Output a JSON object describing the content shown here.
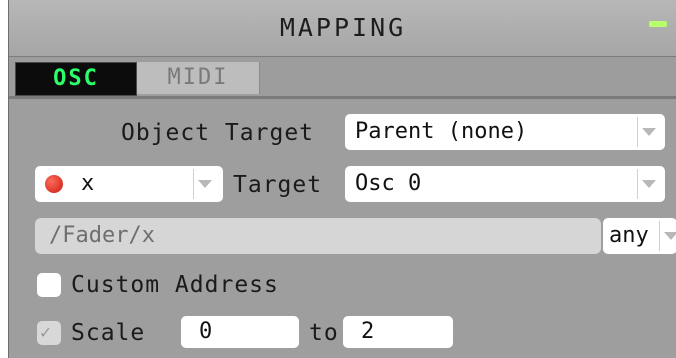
{
  "panel": {
    "title": "MAPPING",
    "minimize_color": "#b9ff6a"
  },
  "tabs": [
    {
      "label": "OSC",
      "active": true
    },
    {
      "label": "MIDI",
      "active": false
    }
  ],
  "object_target": {
    "label": "Object Target",
    "value": "Parent (none)"
  },
  "param": {
    "value": "x",
    "dot_color": "#d6261b"
  },
  "target": {
    "label": "Target",
    "value": "Osc 0"
  },
  "address": {
    "value": "/Fader/x",
    "type_value": "any"
  },
  "custom_address": {
    "label": "Custom Address",
    "checked": false
  },
  "scale": {
    "label": "Scale",
    "checked": true,
    "min": "0",
    "to_label": "to",
    "max": "2"
  }
}
